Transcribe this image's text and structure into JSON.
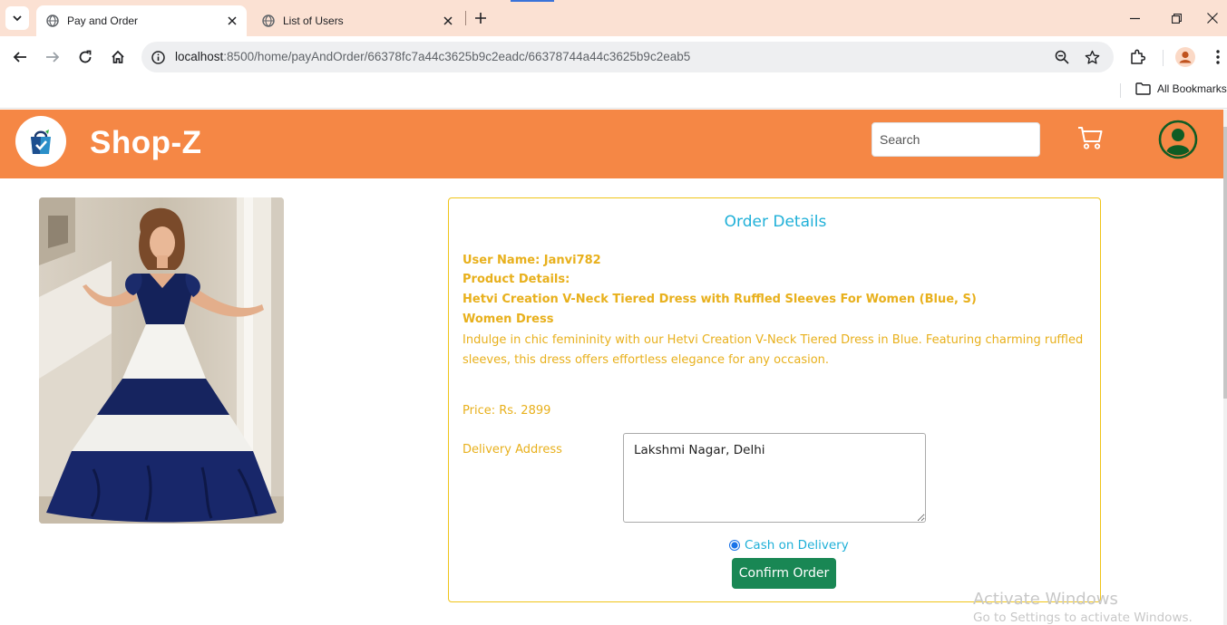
{
  "browser": {
    "tabs": [
      {
        "title": "Pay and Order",
        "active": true
      },
      {
        "title": "List of Users",
        "active": false
      }
    ],
    "url_host": "localhost",
    "url_path": ":8500/home/payAndOrder/66378fc7a44c3625b9c2eadc/66378744a44c3625b9c2eab5",
    "bookmarks_label": "All Bookmarks",
    "icons": [
      "tab-search-icon",
      "globe-icon",
      "close-icon",
      "plus-icon",
      "minimize-icon",
      "restore-icon",
      "back-icon",
      "forward-icon",
      "reload-icon",
      "home-icon",
      "site-info-icon",
      "zoom-icon",
      "star-icon",
      "extensions-icon",
      "profile-icon",
      "kebab-menu-icon",
      "folder-icon"
    ]
  },
  "navbar": {
    "brand": "Shop-Z",
    "search_placeholder": "Search",
    "bg_color": "#f58745",
    "icons": [
      "shopping-bag-logo-icon",
      "cart-icon",
      "user-avatar-icon"
    ]
  },
  "order": {
    "title": "Order Details",
    "user_name": "User Name: Janvi782",
    "product_details_label": "Product Details:",
    "product_name": "Hetvi Creation V-Neck Tiered Dress with Ruffled Sleeves For Women (Blue, S)",
    "category": "Women Dress",
    "description": "Indulge in chic femininity with our Hetvi Creation V-Neck Tiered Dress in Blue. Featuring charming ruffled sleeves, this dress offers effortless elegance for any occasion.",
    "price": "Price: Rs. 2899",
    "delivery_label": "Delivery Address",
    "delivery_address": "Lakshmi Nagar, Delhi",
    "payment_option": "Cash on Delivery",
    "payment_selected": true,
    "confirm_label": "Confirm Order",
    "accent_color": "#e8b01c",
    "title_color": "#1fb0d8",
    "button_color": "#198754"
  },
  "watermark": {
    "line1": "Activate Windows",
    "line2": "Go to Settings to activate Windows."
  }
}
